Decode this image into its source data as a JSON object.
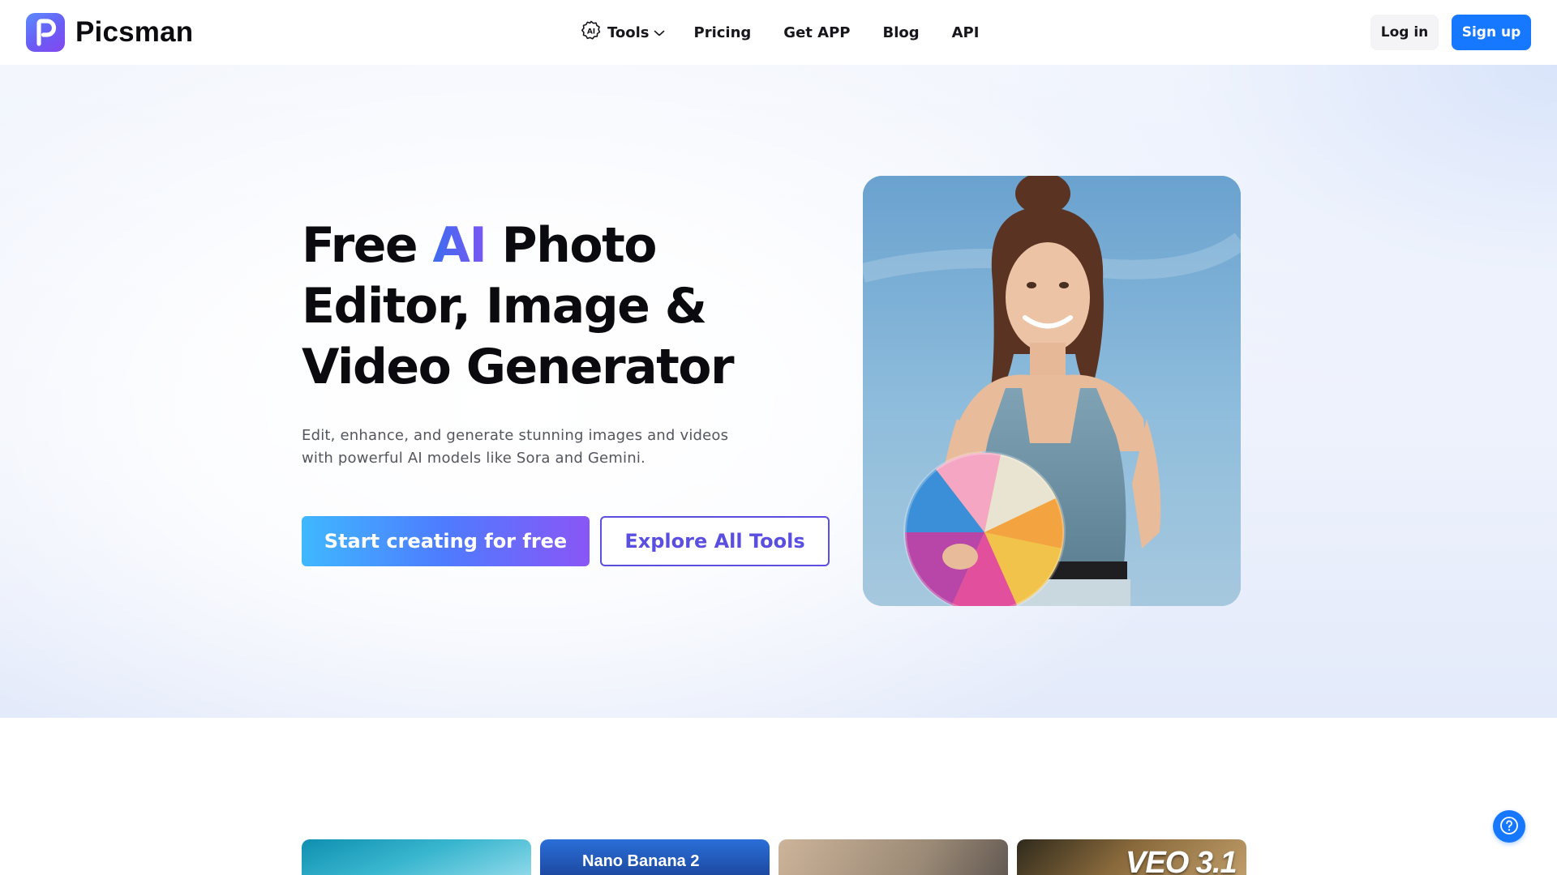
{
  "brand": {
    "name": "Picsman"
  },
  "nav": {
    "tools_label": "Tools",
    "items": [
      "Pricing",
      "Get APP",
      "Blog",
      "API"
    ]
  },
  "auth": {
    "login_label": "Log in",
    "signup_label": "Sign up"
  },
  "hero": {
    "title_part1": "Free ",
    "title_accent": "AI",
    "title_part2": " Photo Editor, Image & Video Generator",
    "subtitle": "Edit, enhance, and generate stunning images and videos with powerful AI models like Sora and Gemini.",
    "primary_cta": "Start creating for free",
    "secondary_cta": "Explore All Tools"
  },
  "tool_cards": [
    {
      "label": ""
    },
    {
      "label": "Nano Banana 2"
    },
    {
      "label": ""
    },
    {
      "label": "VEO 3.1"
    }
  ],
  "colors": {
    "primary": "#1677ff",
    "accent_purple": "#5a4fe0",
    "gradient_start": "#3fb8ff",
    "gradient_end": "#8a56f6"
  },
  "icons": {
    "brand": "picsman-logo-icon",
    "tools": "ai-chip-icon",
    "tools_caret": "chevron-down-icon",
    "help": "help-icon"
  }
}
